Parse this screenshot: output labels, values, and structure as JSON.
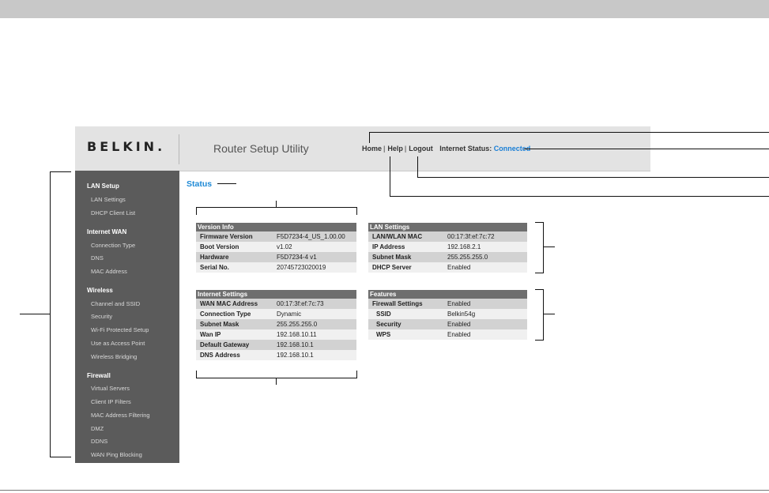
{
  "header": {
    "logo_text": "BELKIN.",
    "app_title": "Router Setup Utility",
    "links": {
      "home": "Home",
      "help": "Help",
      "logout": "Logout",
      "separator": "|"
    },
    "internet_status_label": "Internet Status:",
    "internet_status_value": "Connected",
    "status_color": "#1a7fd6"
  },
  "sidebar": {
    "sections": [
      {
        "title": "LAN Setup",
        "items": [
          "LAN Settings",
          "DHCP Client List"
        ]
      },
      {
        "title": "Internet WAN",
        "items": [
          "Connection Type",
          "DNS",
          "MAC Address"
        ]
      },
      {
        "title": "Wireless",
        "items": [
          "Channel and SSID",
          "Security",
          "Wi-Fi Protected Setup",
          "Use as Access Point",
          "Wireless Bridging"
        ]
      },
      {
        "title": "Firewall",
        "items": [
          "Virtual Servers",
          "Client IP Filters",
          "MAC Address Filtering",
          "DMZ",
          "DDNS",
          "WAN Ping Blocking"
        ]
      }
    ]
  },
  "main": {
    "page_title": "Status",
    "accent_color": "#1f8ad6",
    "version_info": {
      "title": "Version Info",
      "rows": [
        {
          "label": "Firmware Version",
          "value": "F5D7234-4_US_1.00.00"
        },
        {
          "label": "Boot Version",
          "value": "v1.02"
        },
        {
          "label": "Hardware",
          "value": "F5D7234-4 v1"
        },
        {
          "label": "Serial No.",
          "value": "20745723020019"
        }
      ]
    },
    "lan_settings": {
      "title": "LAN Settings",
      "rows": [
        {
          "label": "LAN/WLAN MAC",
          "value": "00:17:3f:ef:7c:72"
        },
        {
          "label": "IP Address",
          "value": "192.168.2.1"
        },
        {
          "label": "Subnet Mask",
          "value": "255.255.255.0"
        },
        {
          "label": "DHCP Server",
          "value": "Enabled"
        }
      ]
    },
    "internet_settings": {
      "title": "Internet Settings",
      "rows": [
        {
          "label": "WAN MAC Address",
          "value": "00:17:3f:ef:7c:73"
        },
        {
          "label": "Connection Type",
          "value": "Dynamic"
        },
        {
          "label": "Subnet Mask",
          "value": "255.255.255.0"
        },
        {
          "label": "Wan IP",
          "value": "192.168.10.11"
        },
        {
          "label": "Default Gateway",
          "value": "192.168.10.1"
        },
        {
          "label": "DNS Address",
          "value": "192.168.10.1"
        }
      ]
    },
    "features": {
      "title": "Features",
      "rows": [
        {
          "label": "Firewall Settings",
          "value": "Enabled"
        },
        {
          "label": "SSID",
          "value": "Belkin54g"
        },
        {
          "label": "Security",
          "value": "Enabled"
        },
        {
          "label": "WPS",
          "value": "Enabled"
        }
      ]
    }
  }
}
